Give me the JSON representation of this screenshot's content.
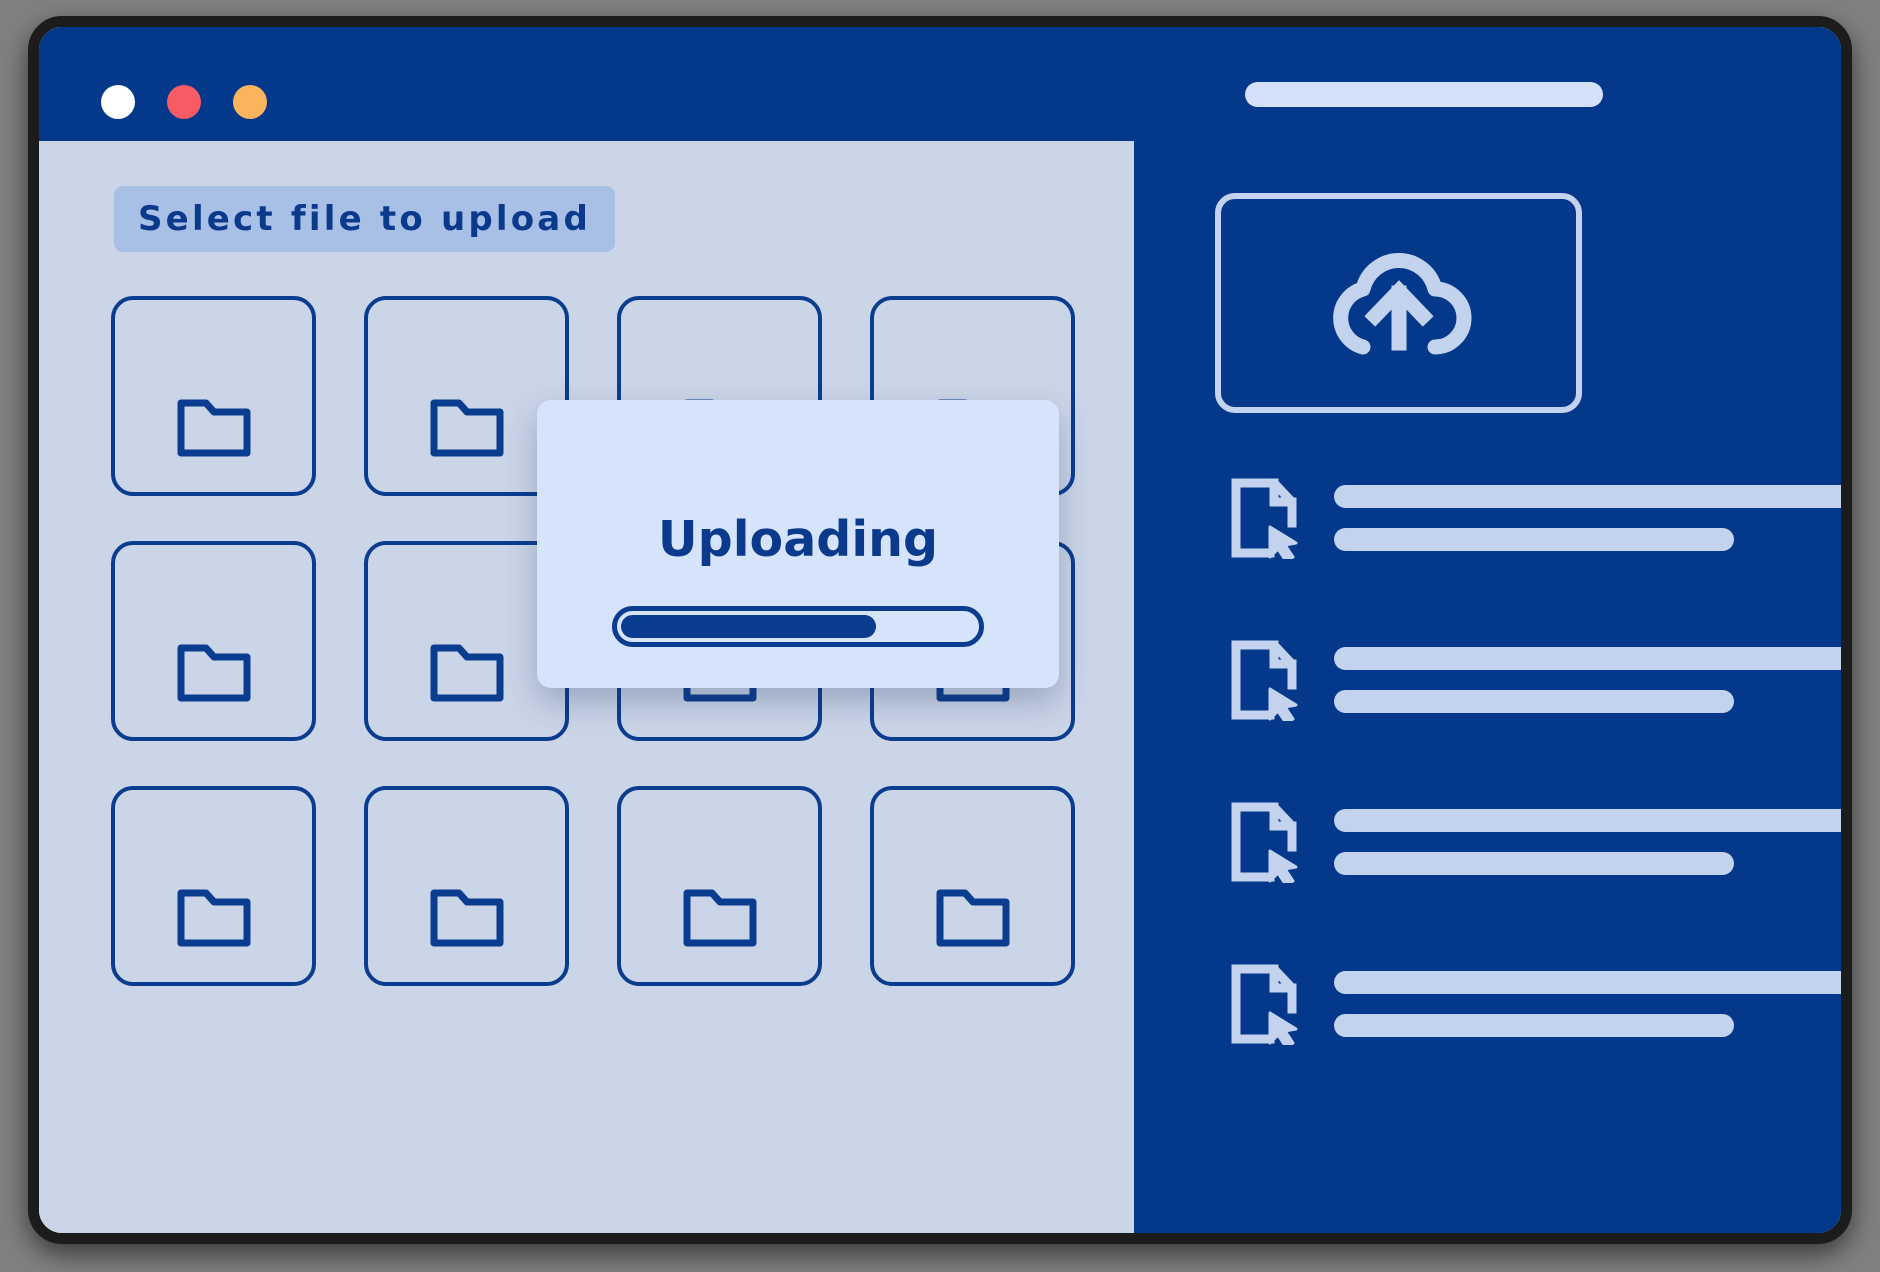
{
  "window": {
    "titlebar": {
      "dots": [
        {
          "name": "close-dot",
          "color": "#ffffff"
        },
        {
          "name": "minimize-dot",
          "color": "#f75c65"
        },
        {
          "name": "maximize-dot",
          "color": "#f9b45d"
        }
      ],
      "address_bar_placeholder": ""
    },
    "frame_color": "#1c1c1c",
    "accent_color": "#03388b"
  },
  "main": {
    "section_label": "Select file to upload",
    "folder_tiles": [
      {
        "label": "",
        "icon": "folder-icon"
      },
      {
        "label": "",
        "icon": "folder-icon"
      },
      {
        "label": "",
        "icon": "folder-icon"
      },
      {
        "label": "",
        "icon": "folder-icon"
      },
      {
        "label": "",
        "icon": "folder-icon"
      },
      {
        "label": "",
        "icon": "folder-icon"
      },
      {
        "label": "",
        "icon": "folder-icon"
      },
      {
        "label": "",
        "icon": "folder-icon"
      },
      {
        "label": "",
        "icon": "folder-icon"
      },
      {
        "label": "",
        "icon": "folder-icon"
      },
      {
        "label": "",
        "icon": "folder-icon"
      },
      {
        "label": "",
        "icon": "folder-icon"
      }
    ]
  },
  "sidebar": {
    "upload_dropzone": {
      "icon": "cloud-upload-icon",
      "label": ""
    },
    "file_items": [
      {
        "icon": "file-select-icon",
        "primary_text": "",
        "secondary_text": ""
      },
      {
        "icon": "file-select-icon",
        "primary_text": "",
        "secondary_text": ""
      },
      {
        "icon": "file-select-icon",
        "primary_text": "",
        "secondary_text": ""
      },
      {
        "icon": "file-select-icon",
        "primary_text": "",
        "secondary_text": ""
      }
    ]
  },
  "modal": {
    "title": "Uploading",
    "progress_percent": 72,
    "background_color": "#d6e4fb",
    "fill_color": "#0a3c8f"
  },
  "colors": {
    "navy": "#03388b",
    "deep_navy": "#0a3c8f",
    "panel_blue_grey": "#cbd5e8",
    "chip_blue": "#a9c0e6",
    "light_blue": "#d6e4fb",
    "sidebar_icon": "#c3d3ee"
  }
}
